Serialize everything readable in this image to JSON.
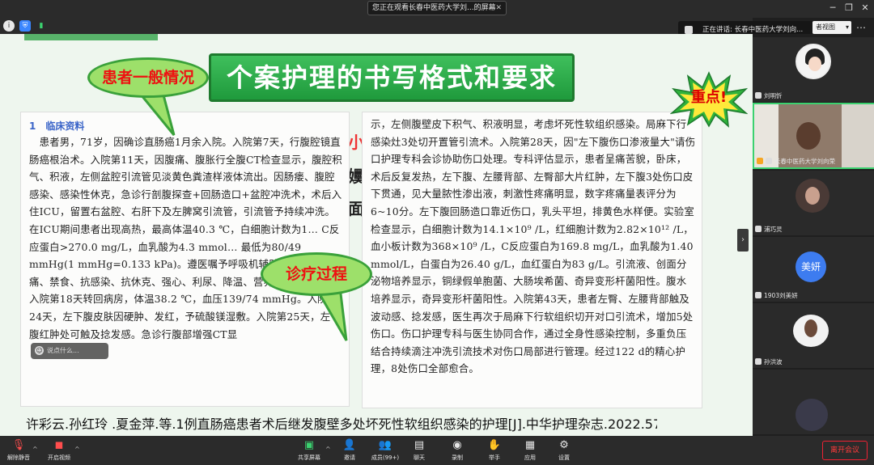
{
  "window": {
    "share_banner": "您正在观看长春中医药大学刘...的屏幕",
    "speaking_label": "正在讲话: 长春中医药大学刘向...",
    "view_button": "者视图"
  },
  "slide": {
    "title": "个案护理的书写格式和要求",
    "bubble_general": "患者一般情况",
    "bubble_treatment": "诊疗过程",
    "star_label": "重点!",
    "behind_text_1": "小",
    "behind_text_2": "嬽д",
    "behind_text_3": "面",
    "section_heading": "1　临床资料",
    "left_text": "　患者男，71岁，因确诊直肠癌1月余入院。入院第7天，行腹腔镜直肠癌根治术。入院第11天，因腹痛、腹胀行全腹CT检查显示，腹腔积气、积液，左侧盆腔引流管见淡黄色粪渣样液体流出。因肠瘘、腹腔感染、感染性休克，急诊行剖腹探查+回肠造口+盆腔冲洗术，术后入住ICU，留置右盆腔、右肝下及左脾窝引流管，引流管予持续冲洗。在ICU期间患者出现高热，最高体温40.3 ℃，白细胞计数为1… C反应蛋白>270.0 mg/L，血乳酸为4.3 mmol… 最低为80/49 mmHg(1 mmHg=0.133 kPa)。遵医嘱予呼吸机辅助通气、镇静止痛、禁食、抗感染、抗休克、强心、利尿、降温、营养支持等治疗。入院第18天转回病房，体温38.2 ℃，血压139/74 mmHg。入院第24天，左下腹皮肤因硬肿、发红，予硫酸镁湿敷。入院第25天，左下腹红肿处可触及捻发感。急诊行腹部增强CT显",
    "right_text": "示，左侧腹壁皮下积气、积液明显，考虑坏死性软组织感染。局麻下行感染灶3处切开置管引流术。入院第28天，因\"左下腹伤口渗液量大\"请伤口护理专科会诊协助伤口处理。专科评估显示，患者呈痛苦貌，卧床，术后反复发热，左下腹、左腰背部、左臀部大片红肿，左下腹3处伤口皮下贯通，见大量脓性渗出液，刺激性疼痛明显，数字疼痛量表评分为6~10分。左下腹回肠造口靠近伤口，乳头平坦，排黄色水样便。实验室检查显示，白细胞计数为14.1×10⁹ /L，红细胞计数为2.82×10¹² /L，血小板计数为368×10⁹ /L，C反应蛋白为169.8 mg/L，血乳酸为1.40 mmol/L，白蛋白为26.40 g/L，血红蛋白为83 g/L。引流液、创面分泌物培养显示，铜绿假单胞菌、大肠埃希菌、奇异变形杆菌阳性。腹水培养显示，奇异变形杆菌阳性。入院第43天，患者左臀、左腰背部触及波动感、捻发感，医生再次于局麻下行软组织切开对口引流术，增加5处伤口。伤口护理专科与医生协同合作，通过全身性感染控制，多重负压结合持续滴注冲洗引流技术对伤口局部进行管理。经过122 d的精心护理，8处伤口全部愈合。",
    "citation": "许彩云.孙红玲 .夏金萍.等.1例直肠癌患者术后继发腹壁多处坏死性软组织感染的护理[J].中华护理杂志.2022.57(18):2247-51"
  },
  "chat_placeholder": "说点什么...",
  "participants": [
    {
      "name": "刘明忻"
    },
    {
      "name": "长春中医药大学刘向荣"
    },
    {
      "name": "浦巧灵"
    },
    {
      "name": "1903刘美妍",
      "avatar_text": "美妍"
    },
    {
      "name": "孙洪波"
    },
    {
      "name": ""
    }
  ],
  "toolbar": {
    "mute": "解除静音",
    "video": "开启视频",
    "share": "共享屏幕",
    "invite": "邀请",
    "members": "成员(99+)",
    "chat": "聊天",
    "record": "录制",
    "raise_hand": "举手",
    "apps": "应用",
    "settings": "设置",
    "leave": "离开会议"
  },
  "colors": {
    "accent_green": "#1f9a3c",
    "bubble_text": "#e11111",
    "leave_red": "#ff3b3b",
    "avatar_blue": "#3d7cf0"
  }
}
